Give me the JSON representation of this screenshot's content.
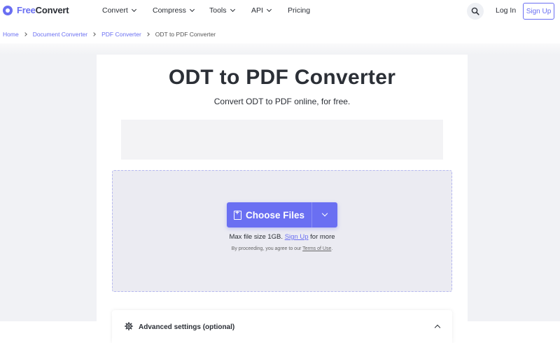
{
  "nav": {
    "logo_free": "Free",
    "logo_convert": "Convert",
    "items": [
      {
        "label": "Convert"
      },
      {
        "label": "Compress"
      },
      {
        "label": "Tools"
      },
      {
        "label": "API"
      },
      {
        "label": "Pricing"
      }
    ],
    "login_label": "Log In",
    "signup_label": "Sign Up",
    "search_icon": "search-icon"
  },
  "breadcrumb": {
    "items": [
      "Home",
      "Document Converter",
      "PDF Converter"
    ],
    "current": "ODT to PDF Converter"
  },
  "hero": {
    "title": "ODT to PDF Converter",
    "subtitle": "Convert ODT to PDF online, for free."
  },
  "upload": {
    "choose_label": "Choose Files",
    "max_prefix": "Max file size 1GB.",
    "max_link": "Sign Up",
    "max_suffix": "for more",
    "terms_prefix": "By proceeding, you agree to our",
    "terms_link": "Terms of Use",
    "terms_suffix": "."
  },
  "advanced": {
    "label": "Advanced settings (optional)"
  },
  "colors": {
    "accent": "#6a6ff2",
    "text": "#2b2f36",
    "dropzone_bg": "#ebebf2",
    "band_bg": "#f1f2f5"
  }
}
